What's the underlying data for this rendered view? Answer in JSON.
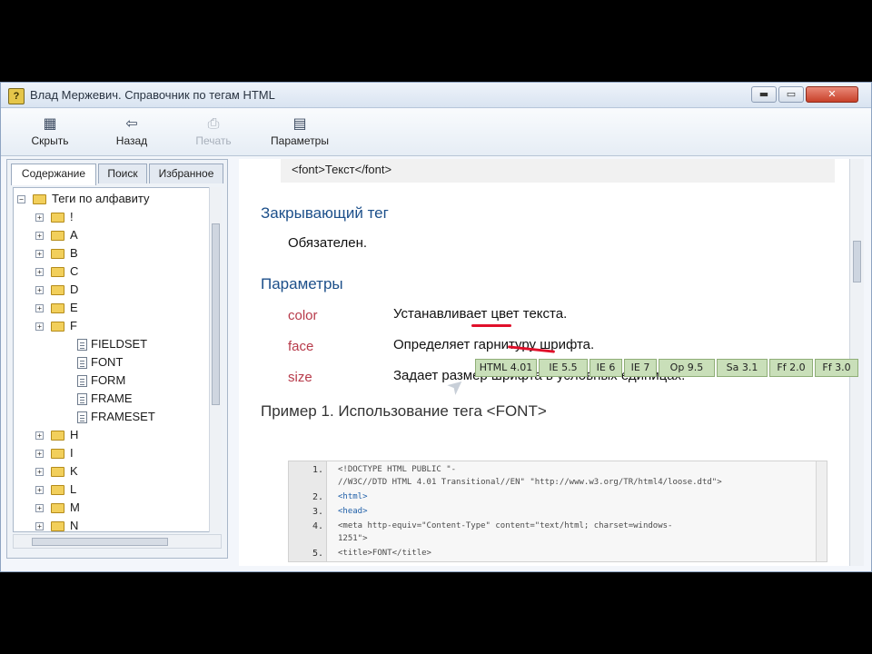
{
  "window": {
    "title": "Влад Мержевич. Справочник по тегам HTML",
    "controls": {
      "min": "▬",
      "max": "▭",
      "close": "✕"
    }
  },
  "toolbar": {
    "items": [
      {
        "label": "Скрыть",
        "icon": "hide-pane-icon",
        "glyph": "▦"
      },
      {
        "label": "Назад",
        "icon": "back-arrow-icon",
        "glyph": "⇦"
      },
      {
        "label": "Печать",
        "icon": "print-icon",
        "glyph": "⎙"
      },
      {
        "label": "Параметры",
        "icon": "options-icon",
        "glyph": "▤"
      }
    ]
  },
  "left": {
    "tabs": [
      "Содержание",
      "Поиск",
      "Избранное"
    ],
    "tree": [
      {
        "label": "Теги по алфавиту",
        "type": "root"
      },
      {
        "label": "!",
        "type": "folder"
      },
      {
        "label": "A",
        "type": "folder"
      },
      {
        "label": "B",
        "type": "folder"
      },
      {
        "label": "C",
        "type": "folder"
      },
      {
        "label": "D",
        "type": "folder"
      },
      {
        "label": "E",
        "type": "folder"
      },
      {
        "label": "F",
        "type": "folder-open"
      },
      {
        "label": "FIELDSET",
        "type": "page"
      },
      {
        "label": "FONT",
        "type": "page"
      },
      {
        "label": "FORM",
        "type": "page"
      },
      {
        "label": "FRAME",
        "type": "page"
      },
      {
        "label": "FRAMESET",
        "type": "page"
      },
      {
        "label": "H",
        "type": "folder"
      },
      {
        "label": "I",
        "type": "folder"
      },
      {
        "label": "K",
        "type": "folder"
      },
      {
        "label": "L",
        "type": "folder"
      },
      {
        "label": "M",
        "type": "folder"
      },
      {
        "label": "N",
        "type": "folder"
      }
    ],
    "expand_glyph": "+"
  },
  "content": {
    "syntax": "<font>Текст</font>",
    "closing_heading": "Закрывающий тег",
    "closing_value": "Обязателен.",
    "params_heading": "Параметры",
    "params": [
      {
        "name": "color",
        "desc": "Устанавливает цвет текста."
      },
      {
        "name": "face",
        "desc": "Определяет гарнитуру шрифта."
      },
      {
        "name": "size",
        "desc": "Задает размер шрифта в условных единицах."
      }
    ],
    "example_heading": "Пример 1. Использование тега <FONT>",
    "badges": [
      "HTML 4.01",
      "IE 5.5",
      "IE 6",
      "IE 7",
      "Op 9.5",
      "Sa 3.1",
      "Ff 2.0",
      "Ff 3.0"
    ],
    "code": [
      {
        "n": "1.",
        "text": "<!DOCTYPE HTML PUBLIC \"-"
      },
      {
        "n": "",
        "text": "//W3C//DTD HTML 4.01 Transitional//EN\" \"http://www.w3.org/TR/html4/loose.dtd\">"
      },
      {
        "n": "2.",
        "text": "<html>"
      },
      {
        "n": "3.",
        "text": "<head>"
      },
      {
        "n": "4.",
        "text": "<meta http-equiv=\"Content-Type\" content=\"text/html; charset=windows-"
      },
      {
        "n": "",
        "text": "1251\">"
      },
      {
        "n": "5.",
        "text": "<title>FONT</title>"
      }
    ]
  }
}
